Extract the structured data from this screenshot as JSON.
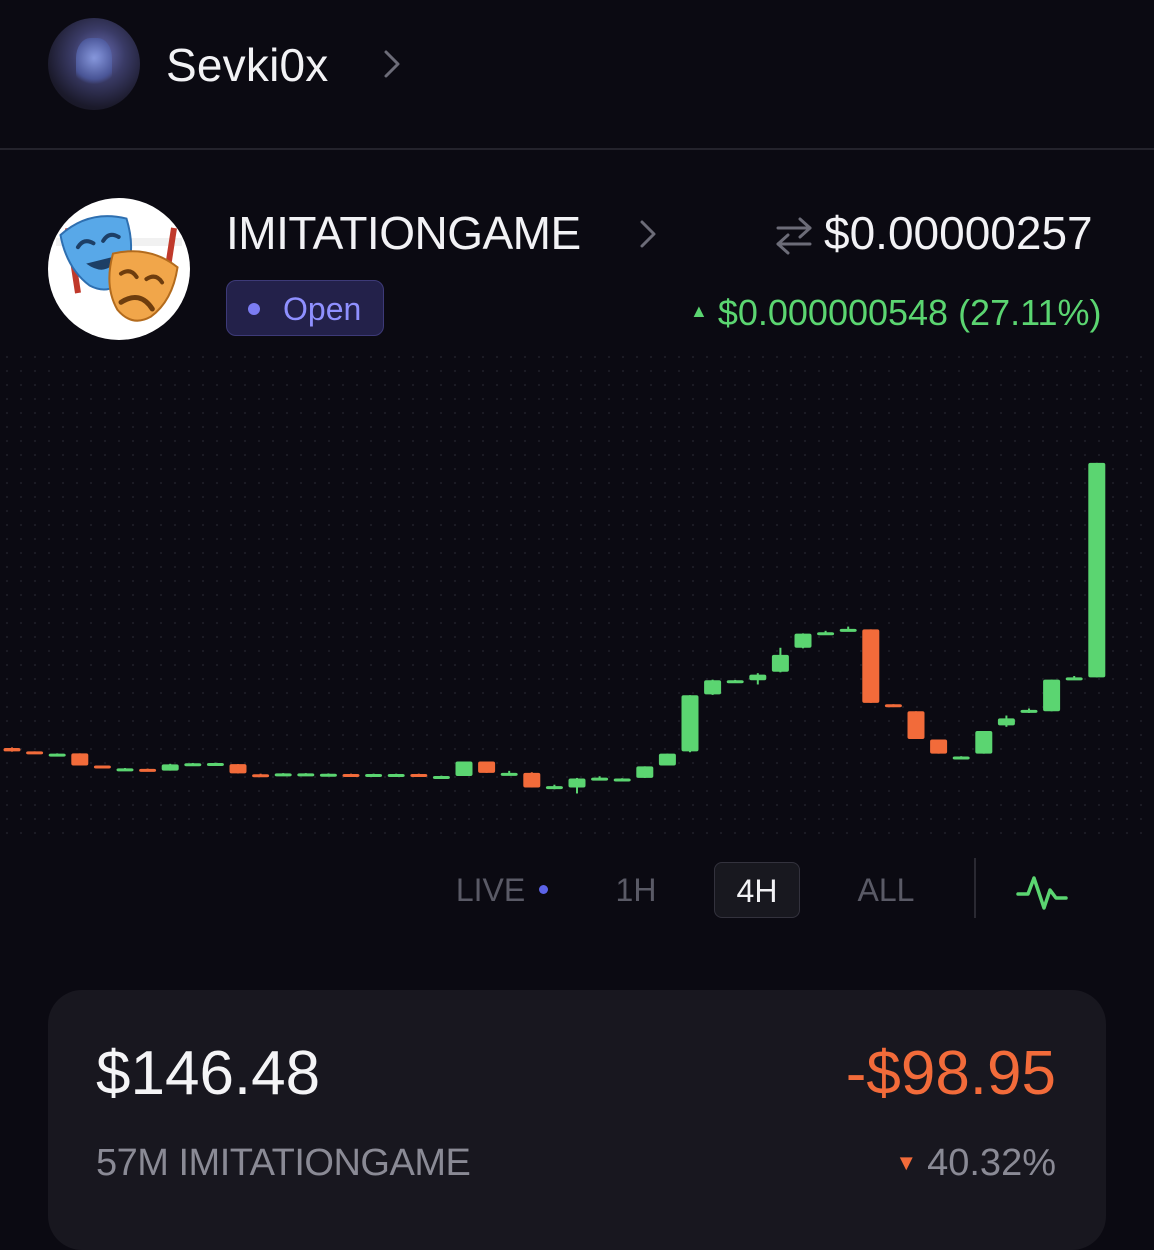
{
  "user": {
    "name": "Sevki0x",
    "avatar_icon": "profile-avatar"
  },
  "token": {
    "name": "IMITATIONGAME",
    "status": "Open",
    "price": "$0.00000257",
    "change": "$0.000000548 (27.11%)",
    "change_direction": "up",
    "logo_icon": "theater-masks-icon"
  },
  "timeframes": [
    {
      "label": "LIVE",
      "active": false
    },
    {
      "label": "1H",
      "active": false
    },
    {
      "label": "4H",
      "active": true
    },
    {
      "label": "ALL",
      "active": false
    }
  ],
  "position": {
    "value": "$146.48",
    "pnl": "-$98.95",
    "holding": "57M IMITATIONGAME",
    "pnl_percent": "40.32%"
  },
  "colors": {
    "up": "#5bd571",
    "down": "#f26b3a",
    "accent": "#7b7cf2",
    "background": "#0b0a12"
  },
  "chart_data": {
    "type": "candlestick",
    "y_scale": "relative",
    "candles": [
      {
        "o": 0.4,
        "c": 0.28,
        "h": 0.42,
        "l": 0.27
      },
      {
        "o": 0.28,
        "c": 0.2,
        "h": 0.28,
        "l": 0.19
      },
      {
        "o": 0.2,
        "c": 0.2,
        "h": 0.21,
        "l": 0.19
      },
      {
        "o": 0.21,
        "c": -0.22,
        "h": 0.21,
        "l": -0.22
      },
      {
        "o": -0.22,
        "c": -0.32,
        "h": -0.22,
        "l": -0.32
      },
      {
        "o": -0.32,
        "c": -0.32,
        "h": -0.31,
        "l": -0.34
      },
      {
        "o": -0.34,
        "c": -0.4,
        "h": -0.33,
        "l": -0.4
      },
      {
        "o": -0.4,
        "c": -0.18,
        "h": -0.16,
        "l": -0.4
      },
      {
        "o": -0.15,
        "c": -0.14,
        "h": -0.13,
        "l": -0.16
      },
      {
        "o": -0.14,
        "c": -0.13,
        "h": -0.12,
        "l": -0.15
      },
      {
        "o": -0.17,
        "c": -0.5,
        "h": -0.17,
        "l": -0.5
      },
      {
        "o": -0.53,
        "c": -0.56,
        "h": -0.51,
        "l": -0.58
      },
      {
        "o": -0.56,
        "c": -0.5,
        "h": -0.49,
        "l": -0.57
      },
      {
        "o": -0.5,
        "c": -0.5,
        "h": -0.49,
        "l": -0.51
      },
      {
        "o": -0.51,
        "c": -0.51,
        "h": -0.5,
        "l": -0.52
      },
      {
        "o": -0.52,
        "c": -0.6,
        "h": -0.51,
        "l": -0.6
      },
      {
        "o": -0.6,
        "c": -0.52,
        "h": -0.51,
        "l": -0.6
      },
      {
        "o": -0.52,
        "c": -0.52,
        "h": -0.51,
        "l": -0.53
      },
      {
        "o": -0.52,
        "c": -0.59,
        "h": -0.51,
        "l": -0.6
      },
      {
        "o": -0.59,
        "c": -0.59,
        "h": -0.58,
        "l": -0.62
      },
      {
        "o": -0.59,
        "c": -0.08,
        "h": -0.08,
        "l": -0.59
      },
      {
        "o": -0.08,
        "c": -0.48,
        "h": -0.08,
        "l": -0.48
      },
      {
        "o": -0.48,
        "c": -0.48,
        "h": -0.41,
        "l": -0.5
      },
      {
        "o": -0.48,
        "c": -1.0,
        "h": -0.46,
        "l": -1.0
      },
      {
        "o": -1.0,
        "c": -0.95,
        "h": -0.9,
        "l": -1.06
      },
      {
        "o": -1.0,
        "c": -0.68,
        "h": -0.66,
        "l": -1.21
      },
      {
        "o": -0.68,
        "c": -0.65,
        "h": -0.6,
        "l": -0.7
      },
      {
        "o": -0.68,
        "c": -0.68,
        "h": -0.67,
        "l": -0.69
      },
      {
        "o": -0.66,
        "c": -0.25,
        "h": -0.25,
        "l": -0.66
      },
      {
        "o": -0.22,
        "c": 0.2,
        "h": 0.2,
        "l": -0.22
      },
      {
        "o": 0.28,
        "c": 2.27,
        "h": 2.27,
        "l": 0.25
      },
      {
        "o": 2.3,
        "c": 2.8,
        "h": 2.82,
        "l": 2.28
      },
      {
        "o": 2.8,
        "c": 2.8,
        "h": 2.81,
        "l": 2.79
      },
      {
        "o": 2.8,
        "c": 3.0,
        "h": 3.05,
        "l": 2.65
      },
      {
        "o": 3.1,
        "c": 3.7,
        "h": 3.95,
        "l": 3.08
      },
      {
        "o": 3.95,
        "c": 4.45,
        "h": 4.46,
        "l": 3.93
      },
      {
        "o": 4.45,
        "c": 4.5,
        "h": 4.55,
        "l": 4.44
      },
      {
        "o": 4.55,
        "c": 4.62,
        "h": 4.7,
        "l": 4.54
      },
      {
        "o": 4.6,
        "c": 2.0,
        "h": 4.6,
        "l": 2.0
      },
      {
        "o": 1.95,
        "c": 1.85,
        "h": 1.95,
        "l": 1.85
      },
      {
        "o": 1.7,
        "c": 0.72,
        "h": 1.7,
        "l": 0.72
      },
      {
        "o": 0.7,
        "c": 0.2,
        "h": 0.7,
        "l": 0.2
      },
      {
        "o": 0.1,
        "c": 0.1,
        "h": 0.11,
        "l": 0.09
      },
      {
        "o": 0.2,
        "c": 1.0,
        "h": 1.0,
        "l": 0.2
      },
      {
        "o": 1.2,
        "c": 1.45,
        "h": 1.55,
        "l": 1.15
      },
      {
        "o": 1.65,
        "c": 1.75,
        "h": 1.8,
        "l": 1.64
      },
      {
        "o": 1.7,
        "c": 2.82,
        "h": 2.82,
        "l": 1.7
      },
      {
        "o": 2.86,
        "c": 2.9,
        "h": 2.95,
        "l": 2.85
      },
      {
        "o": 2.9,
        "c": 10.5,
        "h": 10.5,
        "l": 2.9
      }
    ]
  }
}
